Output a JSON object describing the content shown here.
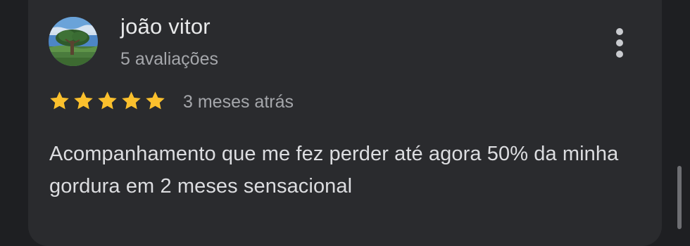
{
  "review": {
    "author_name": "joão vitor",
    "review_count": "5 avaliações",
    "rating": 5,
    "rating_max": 5,
    "date": "3 meses atrás",
    "text": "Acompanhamento que me fez perder até agora 50% da minha gordura em 2 meses sensacional",
    "star_color": "#fbc02d"
  },
  "icons": {
    "avatar": "tree-landscape-avatar",
    "more": "more-vert-icon",
    "star": "star-icon"
  }
}
